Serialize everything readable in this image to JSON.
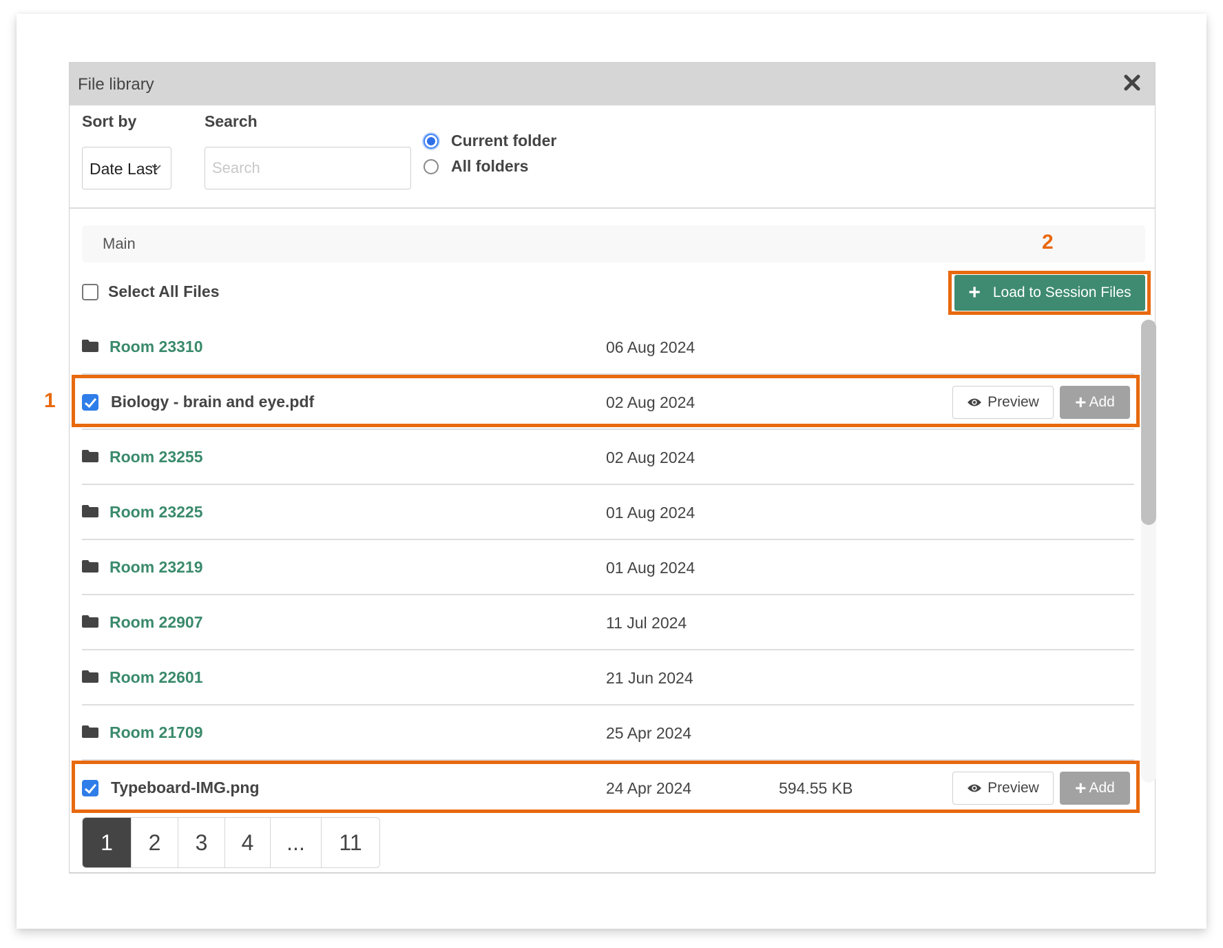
{
  "dialog": {
    "title": "File library",
    "close_icon": "close-icon"
  },
  "toolbar": {
    "sort_label": "Sort by",
    "sort_value": "Date Last",
    "search_label": "Search",
    "search_placeholder": "Search",
    "search_value": "",
    "scope_options": [
      {
        "label": "Current folder",
        "selected": true
      },
      {
        "label": "All folders",
        "selected": false
      }
    ]
  },
  "breadcrumb": {
    "current": "Main"
  },
  "select_all": {
    "label": "Select All Files",
    "checked": false
  },
  "load_button": {
    "label": "Load to Session Files",
    "icon": "plus-icon"
  },
  "annotations": {
    "step1": "1",
    "step2": "2",
    "color": "#e8690e"
  },
  "rows": [
    {
      "type": "folder",
      "name": "Room 23310",
      "date": "06 Aug 2024",
      "size": ""
    },
    {
      "type": "file",
      "name": "Biology - brain and eye.pdf",
      "date": "02 Aug 2024",
      "size": "",
      "checked": true,
      "preview_label": "Preview",
      "add_label": "Add"
    },
    {
      "type": "folder",
      "name": "Room 23255",
      "date": "02 Aug 2024",
      "size": ""
    },
    {
      "type": "folder",
      "name": "Room 23225",
      "date": "01 Aug 2024",
      "size": ""
    },
    {
      "type": "folder",
      "name": "Room 23219",
      "date": "01 Aug 2024",
      "size": ""
    },
    {
      "type": "folder",
      "name": "Room 22907",
      "date": "11 Jul 2024",
      "size": ""
    },
    {
      "type": "folder",
      "name": "Room 22601",
      "date": "21 Jun 2024",
      "size": ""
    },
    {
      "type": "folder",
      "name": "Room 21709",
      "date": "25 Apr 2024",
      "size": ""
    },
    {
      "type": "file",
      "name": "Typeboard-IMG.png",
      "date": "24 Apr 2024",
      "size": "594.55 KB",
      "checked": true,
      "preview_label": "Preview",
      "add_label": "Add"
    }
  ],
  "pagination": {
    "pages": [
      "1",
      "2",
      "3",
      "4",
      "...",
      "11"
    ],
    "current": "1"
  },
  "colors": {
    "accent_green": "#3e8b72",
    "folder_link": "#3a8a6c",
    "checkbox_blue": "#2f7de9",
    "highlight_orange": "#e8690e",
    "add_button_gray": "#a2a2a2"
  }
}
